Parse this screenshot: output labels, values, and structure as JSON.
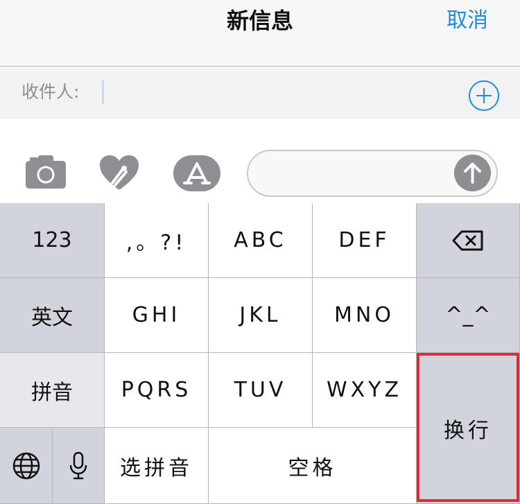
{
  "header": {
    "title": "新信息",
    "cancel_label": "取消"
  },
  "recipient": {
    "label": "收件人:"
  },
  "toolbar": {
    "camera": "camera-icon",
    "digital_touch": "digital-touch-icon",
    "app_store": "app-store-icon"
  },
  "message": {
    "send": "send-arrow-icon"
  },
  "keyboard": {
    "row1": {
      "numbers": "123",
      "punct": ",。?!",
      "abc": "ABC",
      "def": "DEF",
      "delete": "delete-icon"
    },
    "row2": {
      "english": "英文",
      "ghi": "GHI",
      "jkl": "JKL",
      "mno": "MNO",
      "emoticon": "^_^"
    },
    "row3": {
      "pinyin": "拼音",
      "pqrs": "PQRS",
      "tuv": "TUV",
      "wxyz": "WXYZ"
    },
    "row4": {
      "globe": "globe-icon",
      "mic": "mic-icon",
      "select_pinyin": "选拼音",
      "space": "空格"
    },
    "return_label": "换行"
  },
  "colors": {
    "accent": "#1a8cde",
    "highlight": "#e22a36",
    "key_gray": "#d1d4db"
  }
}
